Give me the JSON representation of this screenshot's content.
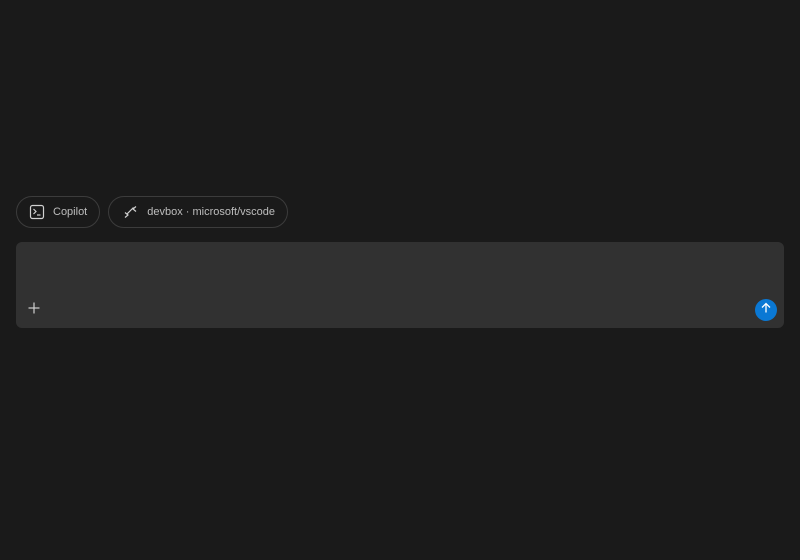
{
  "chips": {
    "agent": {
      "label": "Copilot",
      "icon": "terminal-icon"
    },
    "remote": {
      "label": "devbox · microsoft/vscode",
      "icon": "remote-connection-icon"
    }
  },
  "composer": {
    "placeholder": "",
    "value": "",
    "add_icon": "plus-icon",
    "send_icon": "arrow-up-icon"
  },
  "colors": {
    "background": "#1a1a1a",
    "composer_bg": "#313131",
    "chip_border": "#3c3c3c",
    "accent": "#0a78d4",
    "text_muted": "#bdbdbd"
  }
}
